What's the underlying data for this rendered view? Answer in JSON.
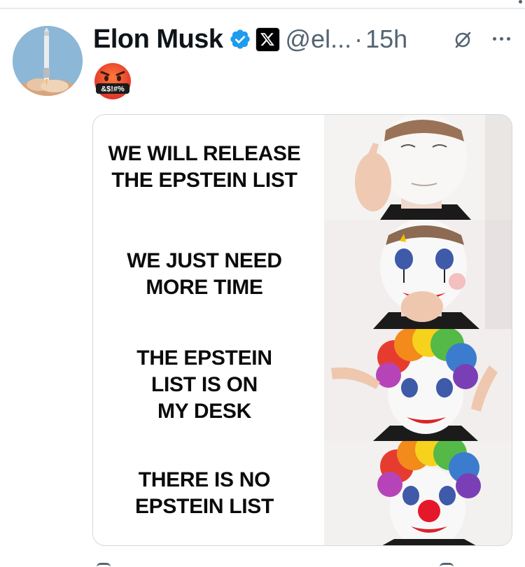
{
  "tweet": {
    "author_name": "Elon Musk",
    "handle": "@el...",
    "separator": "·",
    "time": "15h",
    "emoji_text": "&$!#%",
    "verified_color": "#1d9bf0"
  },
  "meme": {
    "panels": [
      {
        "text": "WE WILL RELEASE\nTHE EPSTEIN LIST",
        "face": "white-face-makeup"
      },
      {
        "text": "WE JUST NEED\nMORE TIME",
        "face": "clown-eye-makeup"
      },
      {
        "text": "THE EPSTEIN\nLIST IS ON\nMY DESK",
        "face": "clown-wig"
      },
      {
        "text": "THERE IS NO\nEPSTEIN LIST",
        "face": "full-clown-nose"
      }
    ]
  },
  "icons": {
    "verified": "verified-badge-icon",
    "affiliation": "x-logo-icon",
    "grok": "grok-icon",
    "more": "more-icon"
  }
}
